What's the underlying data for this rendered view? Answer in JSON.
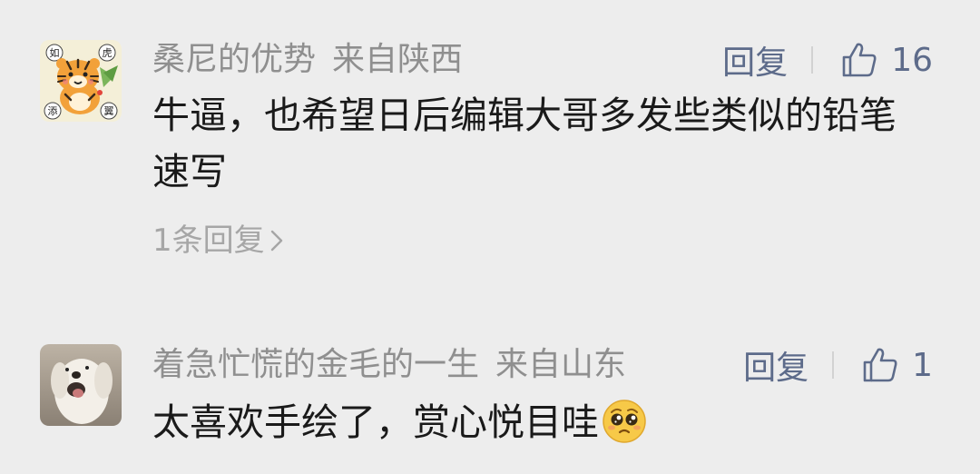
{
  "comments": [
    {
      "author": "桑尼的优势",
      "location": "来自陕西",
      "reply_label": "回复",
      "like_count": "16",
      "text": "牛逼，也希望日后编辑大哥多发些类似的铅笔速写",
      "replies_link": "1条回复",
      "avatar": "tiger-illustration-avatar",
      "avatar_labels": [
        "如",
        "虎",
        "添",
        "翼"
      ]
    },
    {
      "author": "着急忙慌的金毛的一生",
      "location": "来自山东",
      "reply_label": "回复",
      "like_count": "1",
      "text": "太喜欢手绘了，赏心悦目哇",
      "avatar": "dog-photo-avatar",
      "emoji": "pleading-face-emoji"
    }
  ],
  "colors": {
    "background": "#ededed",
    "meta_text": "#8f8f8f",
    "action_text": "#5d6b8a",
    "body_text": "#1a1a1a"
  },
  "icons": {
    "like": "thumbs-up-icon",
    "chevron": "chevron-right-icon"
  }
}
